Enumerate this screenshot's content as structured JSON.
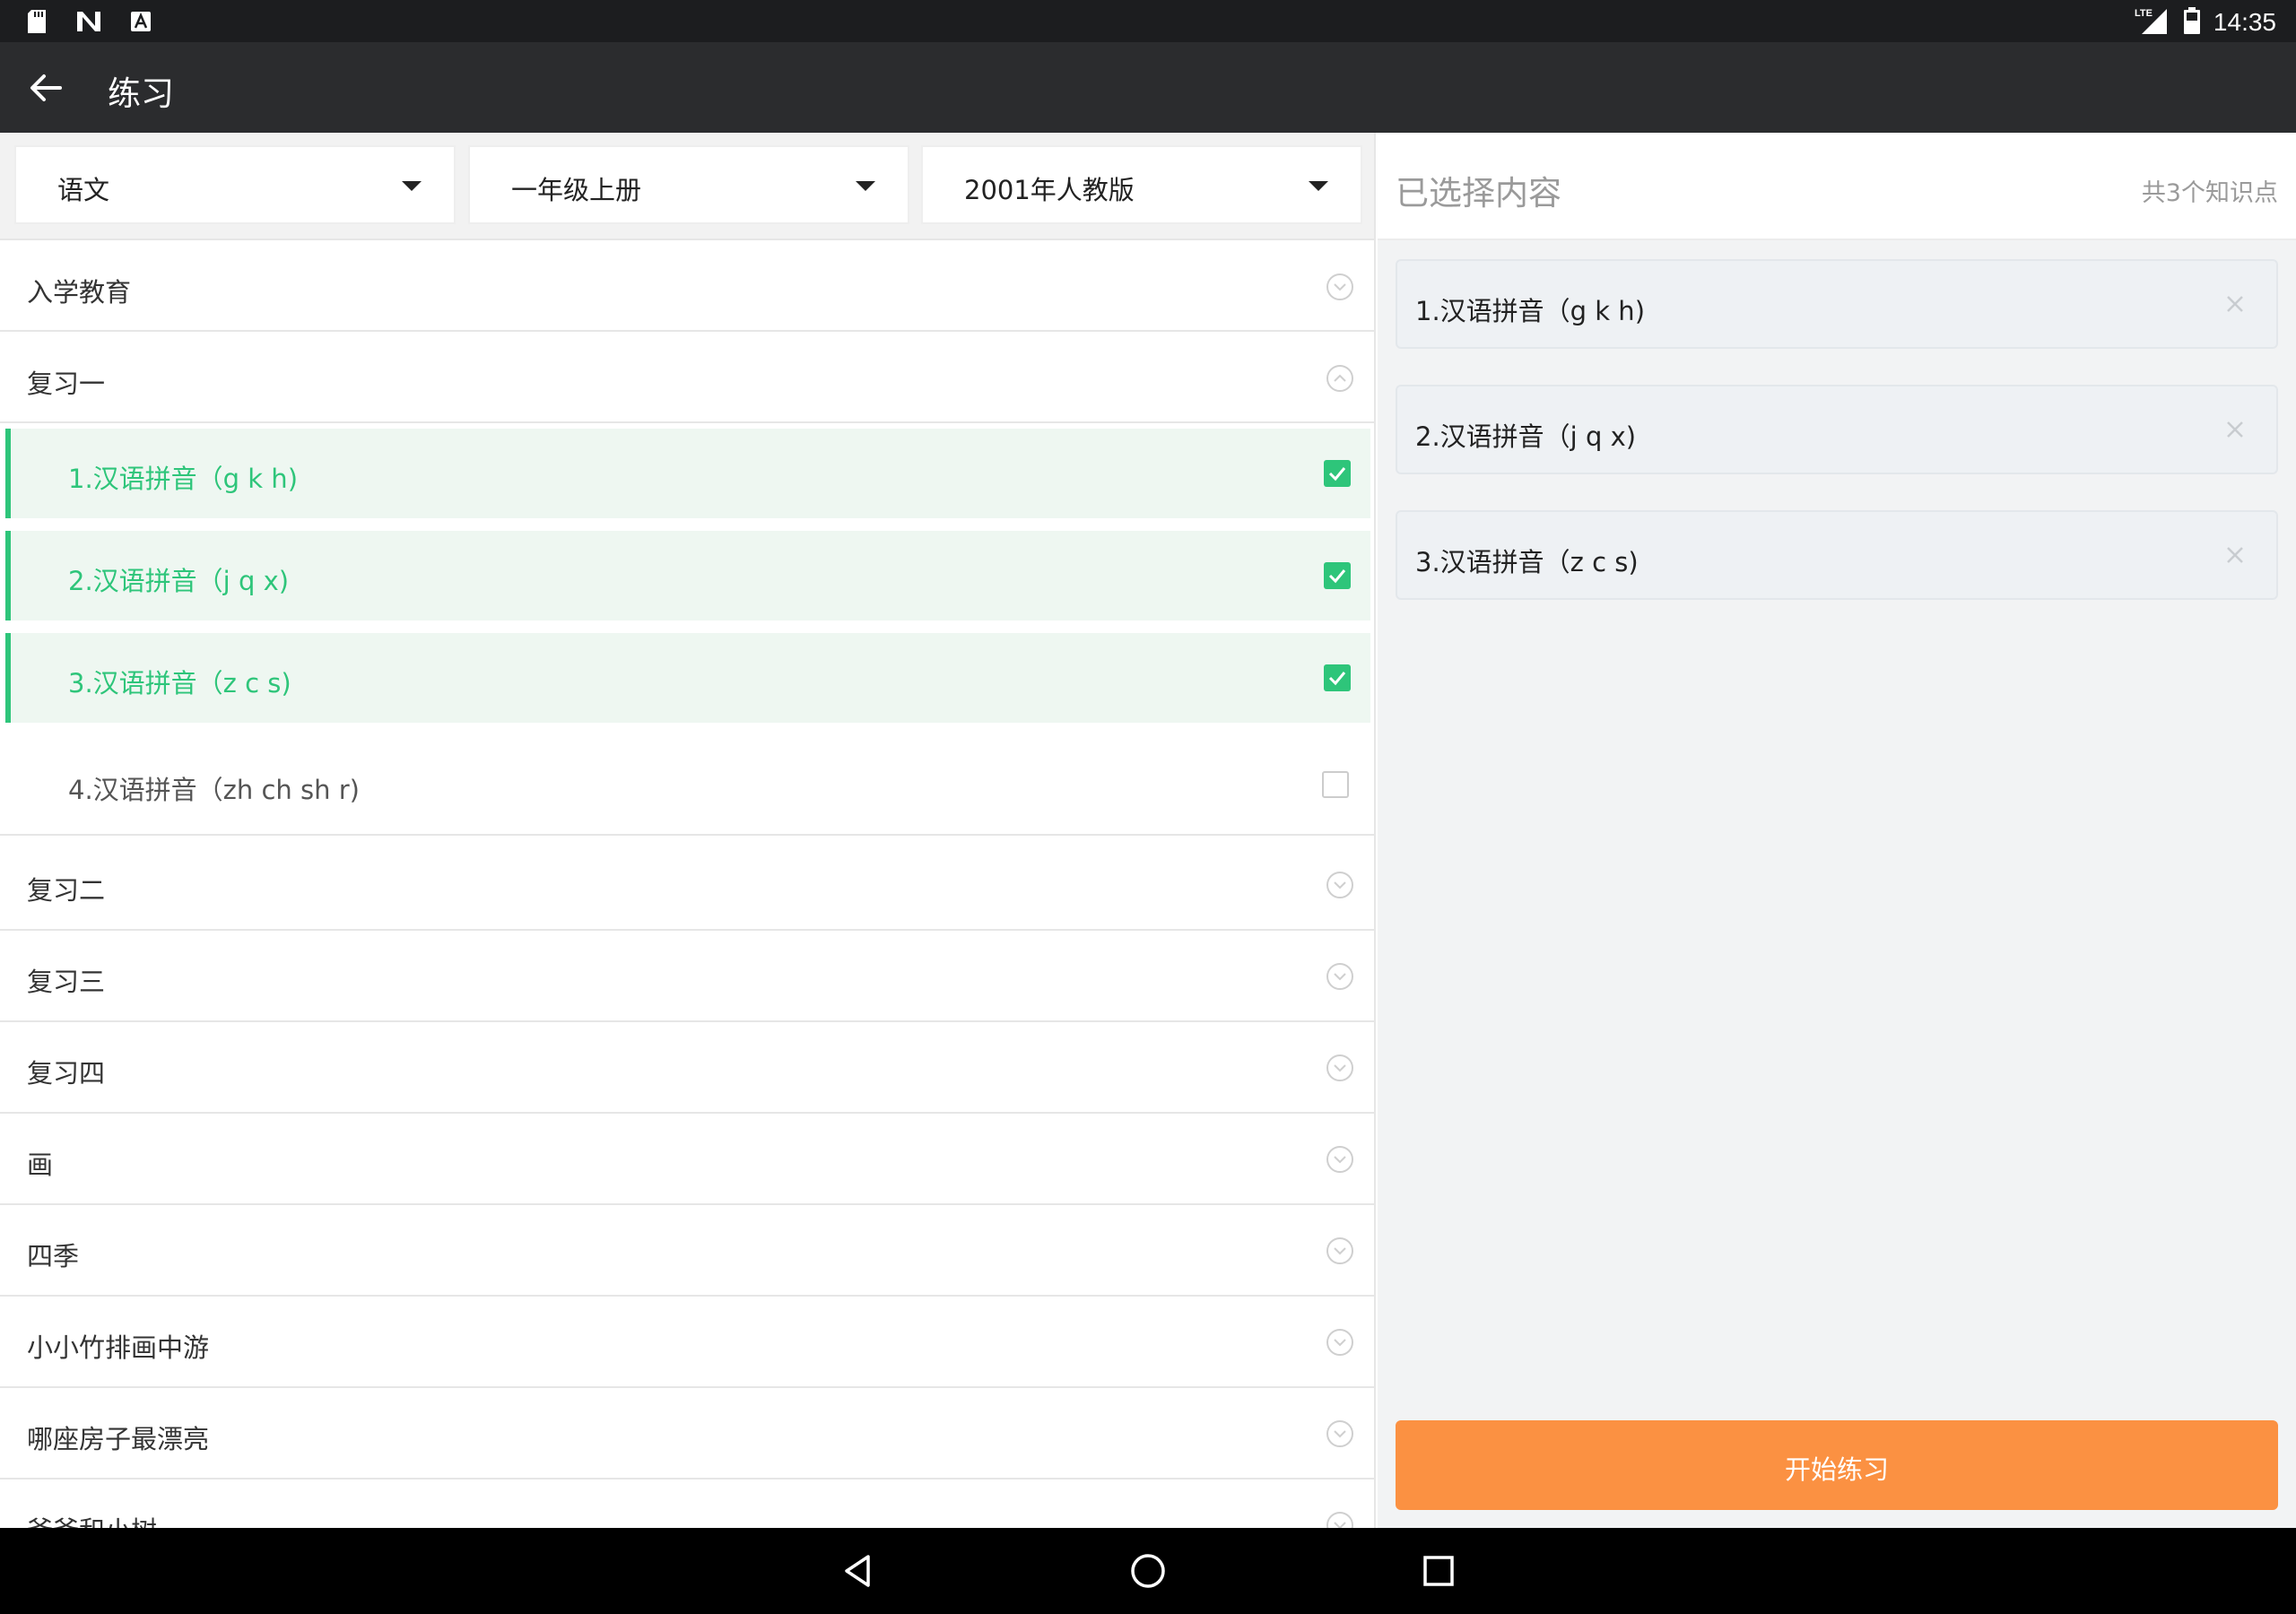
{
  "status_bar": {
    "time": "14:35",
    "left_icons": [
      "sd-card-icon",
      "n-notification-icon",
      "a-notification-icon"
    ],
    "right_icons": [
      "lte-signal-icon",
      "battery-icon"
    ]
  },
  "toolbar": {
    "title": "练习",
    "back_icon": "back-arrow-icon"
  },
  "filters": [
    {
      "label": "语文"
    },
    {
      "label": "一年级上册"
    },
    {
      "label": "2001年人教版"
    }
  ],
  "chapters": {
    "intro": "入学教育",
    "review1": "复习一",
    "review2": "复习二",
    "review3": "复习三",
    "review4": "复习四",
    "hua": "画",
    "siji": "四季",
    "xiaoxiao": "小小竹排画中游",
    "nazuo": "哪座房子最漂亮",
    "yeye": "爷爷和小树"
  },
  "review1_items": [
    {
      "label": "1.汉语拼音（g k h)",
      "checked": true
    },
    {
      "label": "2.汉语拼音（j q x)",
      "checked": true
    },
    {
      "label": "3.汉语拼音（z c s)",
      "checked": true
    },
    {
      "label": "4.汉语拼音（zh ch sh r)",
      "checked": false
    }
  ],
  "selected_panel": {
    "title": "已选择内容",
    "count": "共3个知识点",
    "items": [
      {
        "label": "1.汉语拼音（g k h)"
      },
      {
        "label": "2.汉语拼音（j q x)"
      },
      {
        "label": "3.汉语拼音（z c s)"
      }
    ]
  },
  "start_button": {
    "label": "开始练习"
  },
  "colors": {
    "accent_green": "#2ec57a",
    "selected_bg": "#eef7f1",
    "start_orange": "#fb9142",
    "toolbar_bg": "#2b2c2e"
  }
}
